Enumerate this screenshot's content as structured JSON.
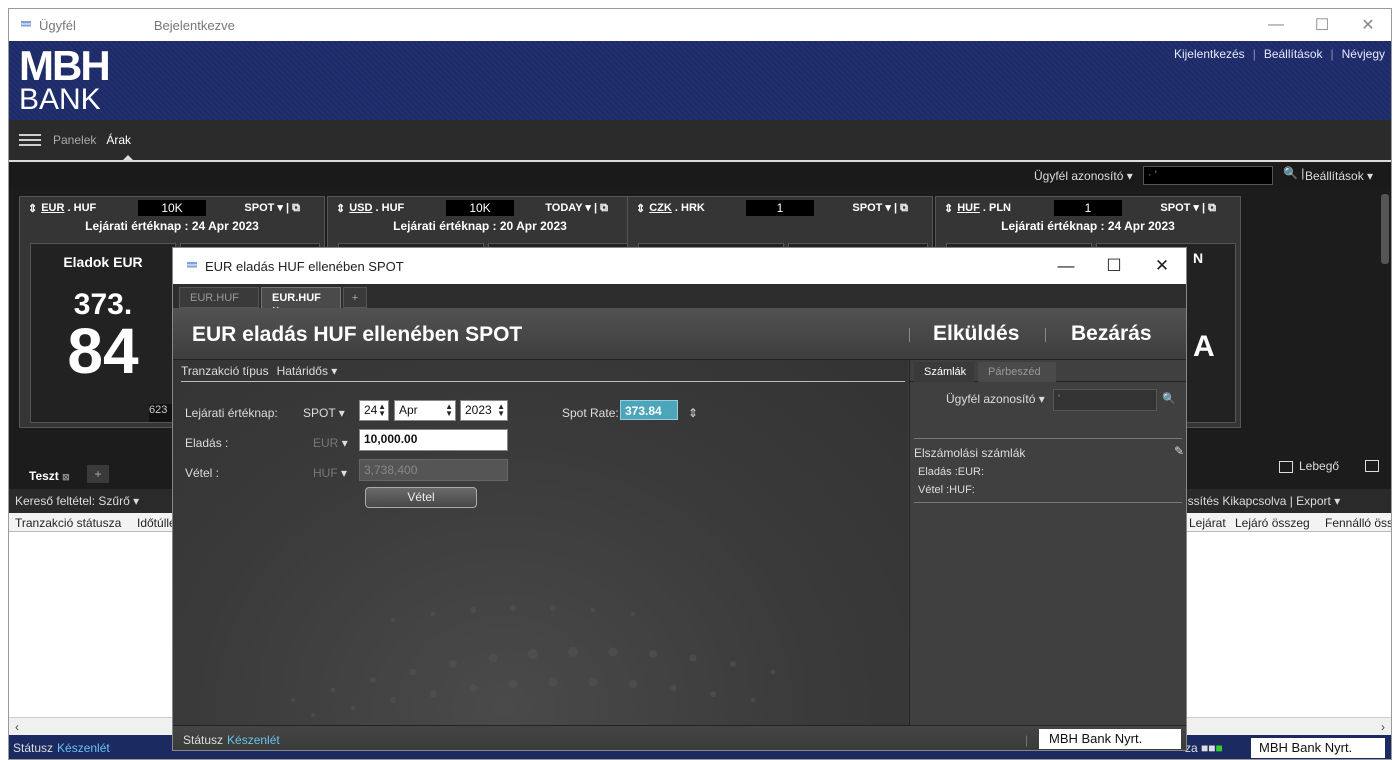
{
  "window": {
    "title": "Ügyfél",
    "status_title": "Bejelentkezve"
  },
  "brand": {
    "logo_top": "MBH",
    "logo_bottom": "BANK"
  },
  "toplinks": [
    "Kijelentkezés",
    "Beállítások",
    "Névjegy"
  ],
  "nav": {
    "items": [
      "Panelek",
      "Árak"
    ],
    "active": "Árak"
  },
  "subbar": {
    "customer_label": "Ügyfél azonosító",
    "settings": "Beállítások"
  },
  "tiles": [
    {
      "pair_a": "EUR",
      "pair_b": "HUF",
      "amount": "10K",
      "tenor": "SPOT",
      "date_line": "Lejárati értéknap : 24 Apr 2023",
      "side": "Eladok EUR",
      "big1": "373.",
      "big2": "84",
      "small": "623"
    },
    {
      "pair_a": "USD",
      "pair_b": "HUF",
      "amount": "10K",
      "tenor": "TODAY",
      "date_line": "Lejárati értéknap : 20 Apr 2023"
    },
    {
      "pair_a": "CZK",
      "pair_b": "HRK",
      "amount": "1",
      "tenor": "SPOT",
      "date_line": ""
    },
    {
      "pair_a": "HUF",
      "pair_b": "PLN",
      "amount": "1",
      "tenor": "SPOT",
      "date_line": "Lejárati értéknap : 24 Apr 2023",
      "partial_right_1": "N",
      "partial_right_2": "A"
    }
  ],
  "blotter": {
    "tab": "Teszt",
    "float_label": "Lebegő",
    "filter_label": "Kereső feltétel:",
    "filter_value": "Szűrő",
    "refresh": "issítés Kikapcsolva",
    "export": "Export",
    "columns_left": [
      "Tranzakció státusza",
      "Időtúllé"
    ],
    "columns_right": [
      "Lejárat",
      "Lejáró összeg",
      "Fennálló öss"
    ]
  },
  "status": {
    "label": "Státusz",
    "value": "Készenlét",
    "right_fragment": "za",
    "bank": "MBH Bank Nyrt."
  },
  "dialog": {
    "title": "EUR eladás HUF ellenében SPOT",
    "tabs": [
      "EUR.HUF",
      "EUR.HUF",
      "+"
    ],
    "header_title": "EUR eladás HUF ellenében SPOT",
    "send": "Elküldés",
    "close": "Bezárás",
    "type_label": "Tranzakció típus",
    "type_value": "Határidős",
    "form": {
      "value_date_label": "Lejárati értéknap:",
      "tenor": "SPOT",
      "day": "24",
      "month": "Apr",
      "year": "2023",
      "spot_rate_label": "Spot Rate:",
      "spot_rate": "373.84",
      "sell_label": "Eladás :",
      "sell_ccy": "EUR",
      "sell_amount": "10,000.00",
      "buy_label": "Vétel :",
      "buy_ccy": "HUF",
      "buy_amount": "3,738,400",
      "action_button": "Vétel"
    },
    "right": {
      "tabs": [
        "Számlák",
        "Párbeszéd"
      ],
      "customer_label": "Ügyfél azonosító",
      "accounts_title": "Elszámolási számlák",
      "sell_account": "Eladás :EUR:",
      "buy_account": "Vétel :HUF:"
    },
    "status_label": "Státusz",
    "status_value": "Készenlét",
    "bank": "MBH Bank Nyrt."
  },
  "icons": [
    "refresh-icon",
    "popout-icon",
    "search-icon",
    "pencil-icon",
    "minimize-icon",
    "maximize-icon",
    "close-icon",
    "hamburger-icon"
  ]
}
